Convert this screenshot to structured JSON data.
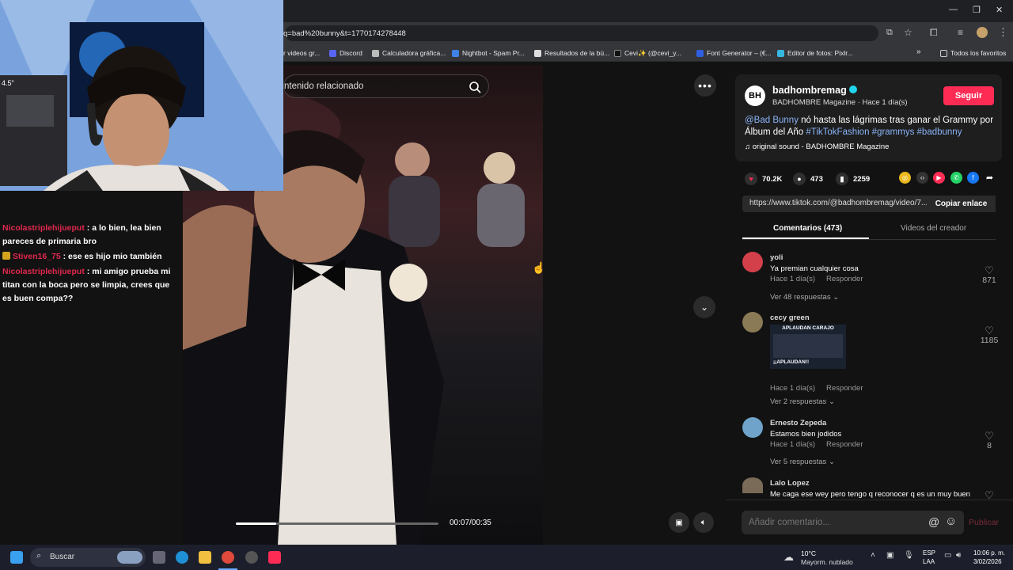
{
  "browser": {
    "url_fragment": "q=bad%20bunny&t=1770174278448",
    "bookmarks": [
      {
        "label": "r videos gr..."
      },
      {
        "label": "Discord"
      },
      {
        "label": "Calculadora gráfica..."
      },
      {
        "label": "Nightbot - Spam Pr..."
      },
      {
        "label": "Resultados de la bú..."
      },
      {
        "label": "Cevi✨ (@cevi_y..."
      },
      {
        "label": "Font Generator – (€..."
      },
      {
        "label": "Editor de fotos: Pixlr..."
      },
      {
        "label": "Todos los favoritos"
      }
    ]
  },
  "chat": {
    "messages": [
      {
        "user": "Nicolastriplehijueput",
        "text": ": a lo bien, lea bien pareces de primaria bro",
        "badge": false
      },
      {
        "user": "Stiven16_75",
        "text": ": ese es hijo mio también",
        "badge": true
      },
      {
        "user": "Nicolastriplehijueput",
        "text": ": mi amigo prueba mi titan con la boca pero se limpia, crees que es buen compa??",
        "badge": false
      }
    ]
  },
  "video": {
    "search_text": "ntenido relacionado",
    "time": "00:07/00:35",
    "progress": 0.2
  },
  "post": {
    "avatar_text": "BH",
    "username": "badhombremag",
    "subtitle": "BADHOMBRE Magazine · Hace 1 día(s)",
    "follow_label": "Seguir",
    "caption_mention": "@Bad Bunny",
    "caption_text": " nó hasta las lágrimas tras ganar el Grammy por Álbum del Año ",
    "caption_tags": "#TikTokFashion #grammys #badbunny",
    "sound": "original sound - BADHOMBRE Magazine",
    "likes": "70.2K",
    "comments": "473",
    "saves": "2259",
    "link": "https://www.tiktok.com/@badhombremag/video/7...",
    "copy_label": "Copiar enlace"
  },
  "tabs": {
    "comments": "Comentarios (473)",
    "creator": "Videos del creador"
  },
  "comments": [
    {
      "name": "yoli",
      "text": "Ya premian cualquier cosa",
      "time": "Hace 1 día(s)",
      "reply": "Responder",
      "more": "Ver 48 respuestas",
      "likes": "871"
    },
    {
      "name": "cecy green",
      "text": "",
      "sticker_top": "APLAUDAN CARAJO",
      "sticker_bottom": "¡¡APLAUDAN!!",
      "time": "Hace 1 día(s)",
      "reply": "Responder",
      "more": "Ver 2 respuestas",
      "likes": "1185"
    },
    {
      "name": "Ernesto Zepeda",
      "text": "Estamos bien jodidos",
      "time": "Hace 1 día(s)",
      "reply": "Responder",
      "more": "Ver 5 respuestas",
      "likes": "8"
    },
    {
      "name": "Lalo Lopez",
      "text": "Me caga ese wey pero tengo q reconocer q es un muy buen",
      "time": "",
      "reply": "",
      "more": "",
      "likes": ""
    }
  ],
  "comment_input": {
    "placeholder": "Añadir comentario...",
    "publish": "Publicar"
  },
  "taskbar": {
    "search": "Buscar",
    "weather_temp": "10°C",
    "weather_desc": "Mayorm. nublado",
    "lang_top": "ESP",
    "lang_bottom": "LAA",
    "clock_time": "10:06 p. m.",
    "clock_date": "3/02/2026"
  },
  "colors": {
    "accent": "#fe2c55",
    "hashtag": "#8ab4f8",
    "chat_user": "#e0284e"
  }
}
